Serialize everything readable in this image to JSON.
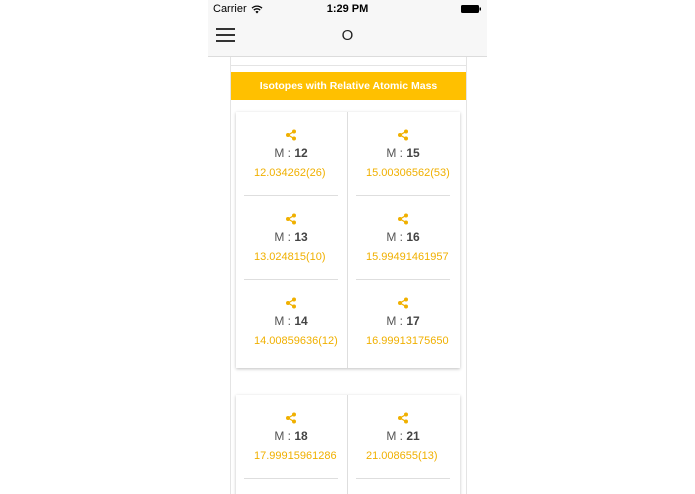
{
  "status_bar": {
    "carrier": "Carrier",
    "time": "1:29 PM"
  },
  "nav": {
    "title": "O"
  },
  "section": {
    "title": "Isotopes with Relative Atomic Mass"
  },
  "mass_prefix": "M : ",
  "isotopes": [
    {
      "mass_number": "12",
      "atomic_mass": "12.034262(26)"
    },
    {
      "mass_number": "15",
      "atomic_mass": "15.00306562(53)"
    },
    {
      "mass_number": "13",
      "atomic_mass": "13.024815(10)"
    },
    {
      "mass_number": "16",
      "atomic_mass": "15.99491461957"
    },
    {
      "mass_number": "14",
      "atomic_mass": "14.00859636(12)"
    },
    {
      "mass_number": "17",
      "atomic_mass": "16.99913175650"
    },
    {
      "mass_number": "18",
      "atomic_mass": "17.99915961286"
    },
    {
      "mass_number": "21",
      "atomic_mass": "21.008655(13)"
    }
  ],
  "colors": {
    "accent": "#ffc000",
    "value_text": "#f0b000",
    "header_text": "#ffffff"
  },
  "icons": {
    "menu": "hamburger-menu-icon",
    "share": "share-icon",
    "wifi": "wifi-icon",
    "battery": "battery-icon"
  }
}
